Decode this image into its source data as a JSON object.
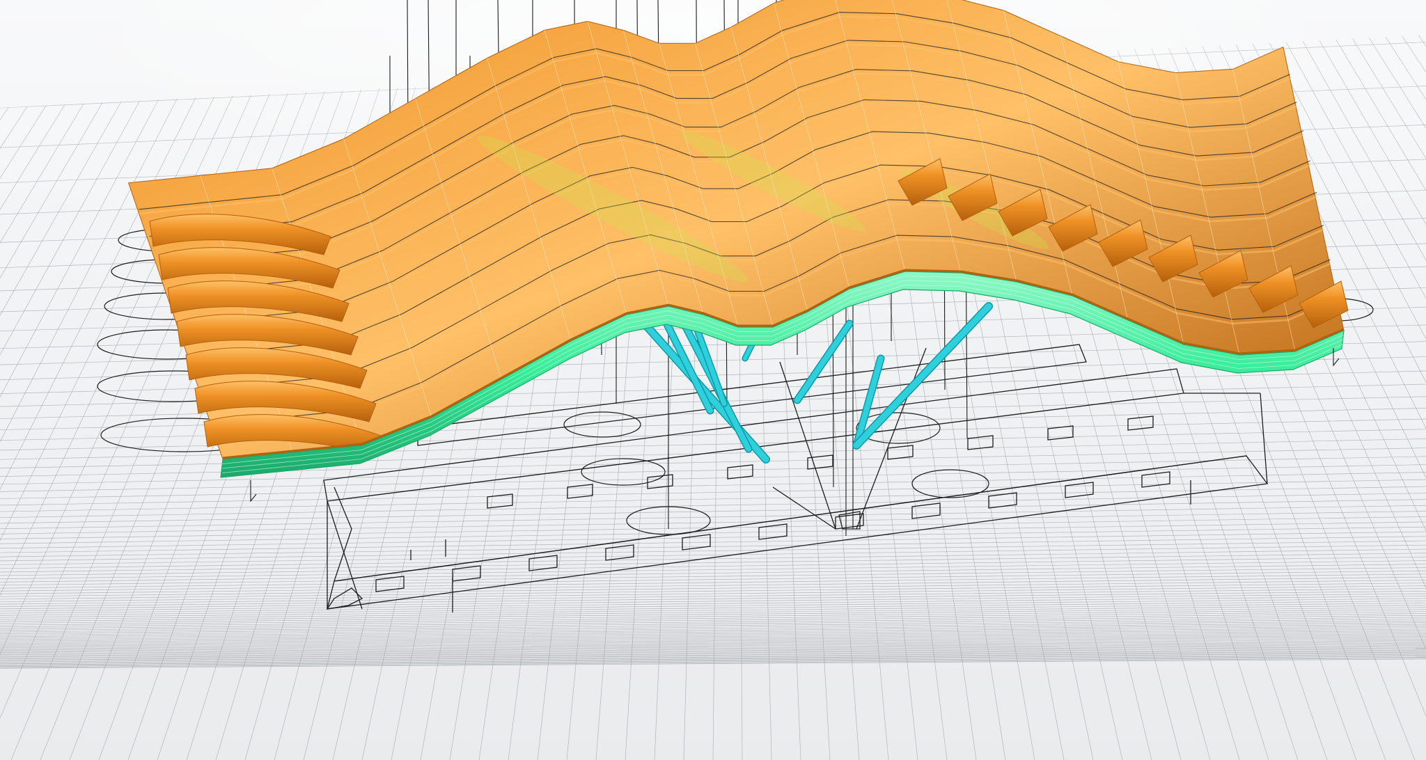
{
  "viewport": {
    "display_mode": "rendered",
    "projection": "perspective",
    "grid_visible": true,
    "background_top_color": "#f7f8f9",
    "background_bottom_color": "#eaebed",
    "grid_color": "#9ea3a8"
  },
  "model": {
    "roof_color": "#ef9226",
    "roof_highlight_color": "#ffc068",
    "roof_shadow_color": "#b5600c",
    "roof_glint_color": "#c8e64a",
    "fascia_color": "#35ec99",
    "fascia_edge_color": "#1ca86a",
    "strut_color": "#2fd0dc",
    "strut_edge_color": "#0a9aa8",
    "wireframe_color": "#1c1c1c"
  }
}
